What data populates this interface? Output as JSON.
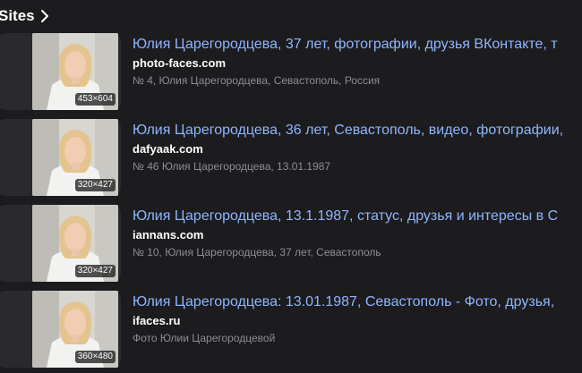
{
  "section": {
    "title": "Sites",
    "icon": "chevron-right-icon"
  },
  "colors": {
    "background": "#1c1c1e",
    "card": "#2a2a2d",
    "title_link": "#8fb5ff",
    "domain": "#ffffff",
    "description": "#8e8e93"
  },
  "results": [
    {
      "title": "Юлия Царегородцева, 37 лет, фотографии, друзья ВКонтакте, т",
      "domain": "photo-faces.com",
      "description": "№ 4, Юлия Царегородцева, Севастополь, Россия",
      "image_size": "453×604"
    },
    {
      "title": "Юлия Царегородцева, 36 лет, Севастополь, видео, фотографии,",
      "domain": "dafyaak.com",
      "description": "№ 46 Юлия Царегородцева, 13.01.1987",
      "image_size": "320×427"
    },
    {
      "title": "Юлия Царегородцева, 13.1.1987, статус, друзья и интересы в С",
      "domain": "iannans.com",
      "description": "№ 10, Юлия Царегородцева, 37 лет, Севастополь",
      "image_size": "320×427"
    },
    {
      "title": "Юлия Царегородцева: 13.01.1987, Севастополь - Фото, друзья,",
      "domain": "ifaces.ru",
      "description": "Фото Юлии Царегородцевой",
      "image_size": "360×480"
    }
  ]
}
